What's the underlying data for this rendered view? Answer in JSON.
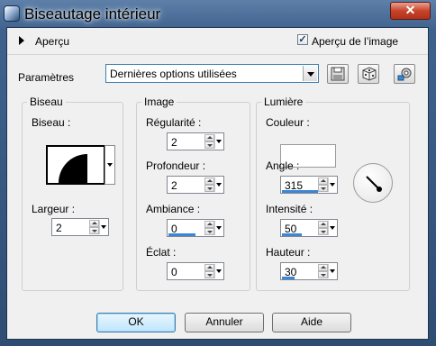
{
  "window": {
    "title": "Biseautage intérieur",
    "close_glyph": "✕"
  },
  "preview_row": {
    "toggle_label": "Aperçu",
    "image_preview_label": "Aperçu de l’image",
    "image_preview_checked": true
  },
  "params": {
    "label": "Paramètres",
    "preset_value": "Dernières options utilisées",
    "buttons": [
      "save-preset-icon",
      "randomize-dice-icon",
      "settings-tools-icon"
    ]
  },
  "biseau": {
    "title": "Biseau",
    "shape_label": "Biseau :",
    "width_label": "Largeur :",
    "width_value": "2"
  },
  "image": {
    "title": "Image",
    "smoothness_label": "Régularité :",
    "smoothness_value": "2",
    "depth_label": "Profondeur :",
    "depth_value": "2",
    "ambience_label": "Ambiance :",
    "ambience_value": "0",
    "shininess_label": "Éclat :",
    "shininess_value": "0"
  },
  "light": {
    "title": "Lumière",
    "color_label": "Couleur :",
    "color_value": "#ffffff",
    "angle_label": "Angle :",
    "angle_value": "315",
    "intensity_label": "Intensité :",
    "intensity_value": "50",
    "height_label": "Hauteur :",
    "height_value": "30"
  },
  "footer": {
    "ok": "OK",
    "cancel": "Annuler",
    "help": "Aide"
  }
}
